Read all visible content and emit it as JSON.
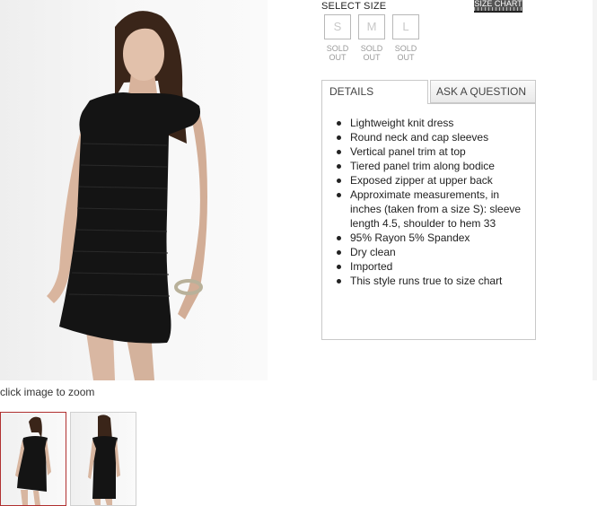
{
  "zoom_hint": "click image to zoom",
  "select_size_label": "SELECT SIZE",
  "size_chart_label": "SIZE CHART",
  "sizes": [
    {
      "label": "S",
      "status": "SOLD OUT"
    },
    {
      "label": "M",
      "status": "SOLD OUT"
    },
    {
      "label": "L",
      "status": "SOLD OUT"
    }
  ],
  "tabs": [
    {
      "label": "DETAILS",
      "active": true
    },
    {
      "label": "ASK A QUESTION",
      "active": false
    }
  ],
  "details": [
    "Lightweight knit dress",
    "Round neck and cap sleeves",
    "Vertical panel trim at top",
    "Tiered panel trim along bodice",
    "Exposed zipper at upper back",
    "Approximate measurements, in inches (taken from a size S): sleeve length 4.5, shoulder to hem 33",
    "95% Rayon 5% Spandex",
    "Dry clean",
    "Imported",
    "This style runs true to size chart"
  ],
  "colors": {
    "active_thumb_border": "#b03030",
    "tab_border": "#c9c9c9",
    "dress": "#141414"
  }
}
